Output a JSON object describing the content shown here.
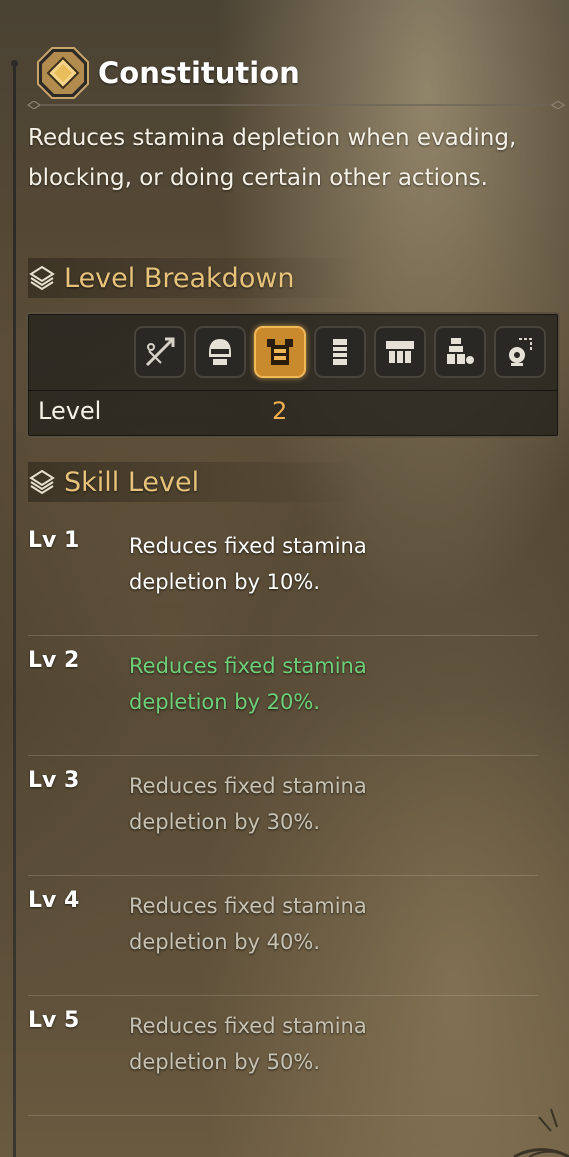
{
  "skill": {
    "title": "Constitution",
    "description": "Reduces stamina depletion when evading, blocking, or doing certain other actions.",
    "icon": "diamond-badge-icon"
  },
  "breakdown": {
    "heading": "Level Breakdown",
    "equipment": [
      {
        "name": "weapon-icon",
        "active": false
      },
      {
        "name": "helm-icon",
        "active": false
      },
      {
        "name": "chest-armor-icon",
        "active": true
      },
      {
        "name": "arm-armor-icon",
        "active": false
      },
      {
        "name": "waist-armor-icon",
        "active": false
      },
      {
        "name": "leg-armor-icon",
        "active": false
      },
      {
        "name": "talisman-icon",
        "active": false
      }
    ],
    "level_label": "Level",
    "level_value": "2"
  },
  "skill_levels": {
    "heading": "Skill Level",
    "colors": {
      "unlocked": "#ffffff",
      "current": "#6fd07a",
      "locked": "#c8c2b3"
    },
    "levels": [
      {
        "label": "Lv 1",
        "desc_line1": "Reduces fixed stamina",
        "desc_line2": "depletion by 10%.",
        "state": "unlocked"
      },
      {
        "label": "Lv 2",
        "desc_line1": "Reduces fixed stamina",
        "desc_line2": "depletion by 20%.",
        "state": "current"
      },
      {
        "label": "Lv 3",
        "desc_line1": "Reduces fixed stamina",
        "desc_line2": "depletion by 30%.",
        "state": "locked"
      },
      {
        "label": "Lv 4",
        "desc_line1": "Reduces fixed stamina",
        "desc_line2": "depletion by 40%.",
        "state": "locked"
      },
      {
        "label": "Lv 5",
        "desc_line1": "Reduces fixed stamina",
        "desc_line2": "depletion by 50%.",
        "state": "locked"
      }
    ]
  }
}
